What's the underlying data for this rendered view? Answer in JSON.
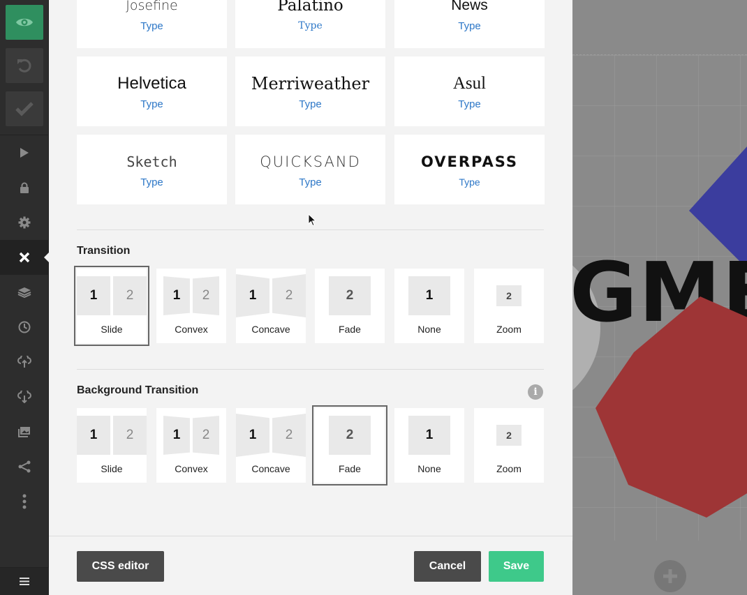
{
  "toolbar": {
    "top_buttons": [
      {
        "name": "preview-button",
        "icon": "eye-icon"
      },
      {
        "name": "undo-button",
        "icon": "undo-icon"
      },
      {
        "name": "publish-button",
        "icon": "checkmark-icon"
      }
    ],
    "items": [
      {
        "name": "present",
        "icon": "play-icon"
      },
      {
        "name": "lock",
        "icon": "lock-icon"
      },
      {
        "name": "settings",
        "icon": "gear-icon"
      },
      {
        "name": "close",
        "icon": "close-icon",
        "active": true
      },
      {
        "name": "layers",
        "icon": "layers-icon"
      },
      {
        "name": "history",
        "icon": "clock-icon"
      },
      {
        "name": "upload",
        "icon": "cloud-upload-icon"
      },
      {
        "name": "download",
        "icon": "cloud-download-icon"
      },
      {
        "name": "media",
        "icon": "image-icon"
      },
      {
        "name": "share",
        "icon": "share-icon"
      },
      {
        "name": "more",
        "icon": "more-vertical-icon"
      }
    ],
    "menu_icon": "hamburger-icon"
  },
  "typography": {
    "type_label": "Type",
    "fonts": [
      {
        "name": "Josefine",
        "link": "Type"
      },
      {
        "name": "Palatino",
        "link": "Type"
      },
      {
        "name": "News",
        "link": "Type"
      },
      {
        "name": "Helvetica",
        "link": "Type"
      },
      {
        "name": "Merriweather",
        "link": "Type"
      },
      {
        "name": "Asul",
        "link": "Type"
      },
      {
        "name": "Sketch",
        "link": "Type"
      },
      {
        "name": "QUICKSAND",
        "link": "Type"
      },
      {
        "name": "OVERPASS",
        "link": "Type"
      }
    ]
  },
  "transition": {
    "title": "Transition",
    "selected": "Slide",
    "options": [
      "Slide",
      "Convex",
      "Concave",
      "Fade",
      "None",
      "Zoom"
    ]
  },
  "background_transition": {
    "title": "Background Transition",
    "info_icon": "info-icon",
    "selected": "Fade",
    "options": [
      "Slide",
      "Convex",
      "Concave",
      "Fade",
      "None",
      "Zoom"
    ]
  },
  "footer": {
    "css_editor": "CSS editor",
    "cancel": "Cancel",
    "save": "Save"
  },
  "canvas": {
    "visible_text": "GME",
    "add_slide_icon": "plus-icon"
  },
  "colors": {
    "accent_green": "#3ec98a",
    "link_blue": "#2d77c7",
    "shape_blue": "#3b3d9e",
    "shape_red": "#9e3536"
  }
}
